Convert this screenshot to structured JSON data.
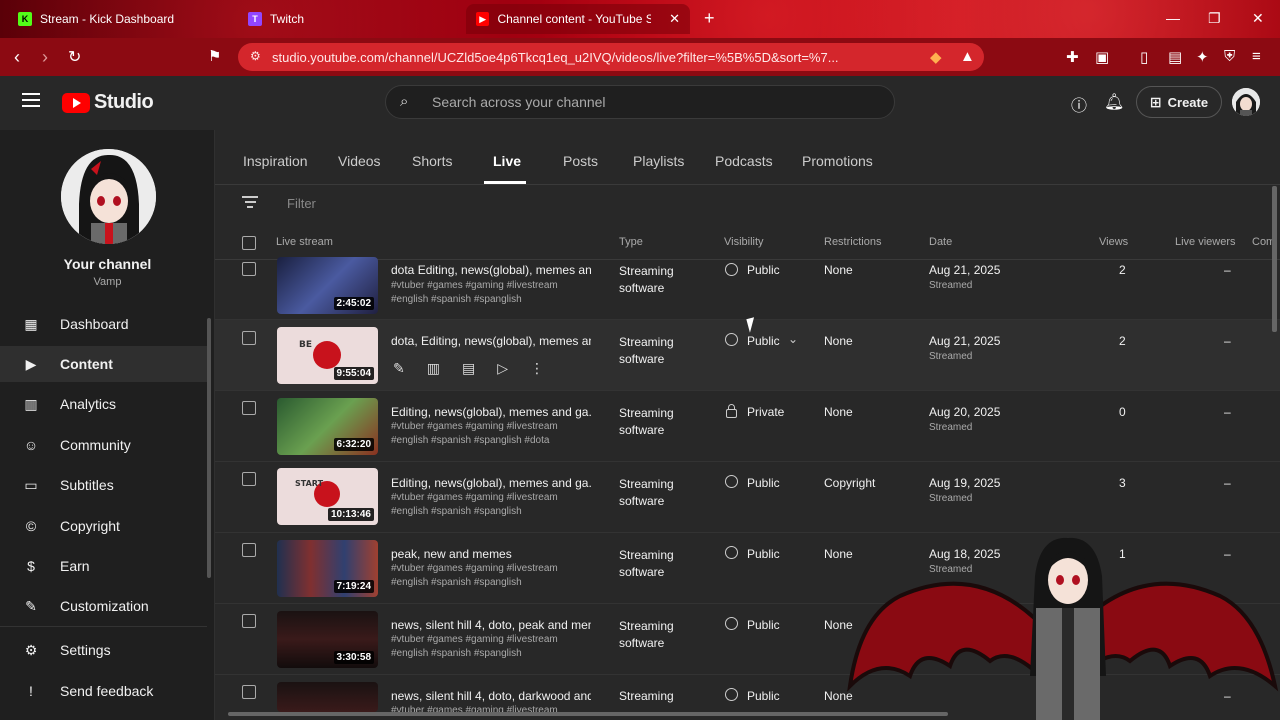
{
  "browser": {
    "tabs": [
      {
        "label": "Stream - Kick Dashboard",
        "fav_color": "#53fc18",
        "fav_glyph": "K"
      },
      {
        "label": "Twitch",
        "fav_color": "#9146ff",
        "fav_glyph": "T"
      },
      {
        "label": "Channel content - YouTube Stud",
        "fav_color": "#ff0000",
        "fav_glyph": "▶"
      }
    ],
    "url": "studio.youtube.com/channel/UCZld5oe4p6Tkcq1eq_u2IVQ/videos/live?filter=%5B%5D&sort=%7..."
  },
  "header": {
    "logo_text": "Studio",
    "search_placeholder": "Search across your channel",
    "create_label": "Create"
  },
  "sidebar": {
    "channel_title": "Your channel",
    "channel_name": "Vamp",
    "items": [
      {
        "label": "Dashboard",
        "icon": "dashboard-icon",
        "glyph": "▦"
      },
      {
        "label": "Content",
        "icon": "content-icon",
        "glyph": "▶"
      },
      {
        "label": "Analytics",
        "icon": "analytics-icon",
        "glyph": "▥"
      },
      {
        "label": "Community",
        "icon": "community-icon",
        "glyph": "☺"
      },
      {
        "label": "Subtitles",
        "icon": "subtitles-icon",
        "glyph": "▭"
      },
      {
        "label": "Copyright",
        "icon": "copyright-icon",
        "glyph": "©"
      },
      {
        "label": "Earn",
        "icon": "earn-icon",
        "glyph": "$"
      },
      {
        "label": "Customization",
        "icon": "customization-icon",
        "glyph": "✎"
      },
      {
        "label": "Settings",
        "icon": "settings-icon",
        "glyph": "⚙"
      },
      {
        "label": "Send feedback",
        "icon": "feedback-icon",
        "glyph": "!"
      }
    ]
  },
  "content_tabs": [
    "Inspiration",
    "Videos",
    "Shorts",
    "Live",
    "Posts",
    "Playlists",
    "Podcasts",
    "Promotions"
  ],
  "filter_placeholder": "Filter",
  "columns": {
    "live_stream": "Live stream",
    "type": "Type",
    "visibility": "Visibility",
    "restrictions": "Restrictions",
    "date": "Date",
    "views": "Views",
    "live_viewers": "Live viewers",
    "comments": "Com"
  },
  "rows": [
    {
      "title": "dota Editing, news(global), memes an...",
      "desc": "#vtuber #games #gaming #livestream #english #spanish #spanglish",
      "duration": "2:45:02",
      "type": "Streaming software",
      "visibility": "Public",
      "restrictions": "None",
      "date": "Aug 21, 2025",
      "date_sub": "Streamed",
      "views": "2",
      "live_viewers": "–",
      "thumb": "#2a3050"
    },
    {
      "title": "dota, Editing, news(global), memes an...",
      "desc": "",
      "duration": "9:55:04",
      "type": "Streaming software",
      "visibility": "Public",
      "restrictions": "None",
      "date": "Aug 21, 2025",
      "date_sub": "Streamed",
      "views": "2",
      "live_viewers": "–",
      "thumb": "#e8d6d6"
    },
    {
      "title": "Editing, news(global), memes and ga...",
      "desc": "#vtuber #games #gaming #livestream #english #spanish #spanglish #dota",
      "duration": "6:32:20",
      "type": "Streaming software",
      "visibility": "Private",
      "restrictions": "None",
      "date": "Aug 20, 2025",
      "date_sub": "Streamed",
      "views": "0",
      "live_viewers": "–",
      "thumb": "#3a6a40"
    },
    {
      "title": "Editing, news(global), memes and ga...",
      "desc": "#vtuber #games #gaming #livestream #english #spanish #spanglish",
      "duration": "10:13:46",
      "type": "Streaming software",
      "visibility": "Public",
      "restrictions": "Copyright",
      "date": "Aug 19, 2025",
      "date_sub": "Streamed",
      "views": "3",
      "live_viewers": "–",
      "thumb": "#ead8d8"
    },
    {
      "title": "peak, new and memes",
      "desc": "#vtuber #games #gaming #livestream #english #spanish #spanglish",
      "duration": "7:19:24",
      "type": "Streaming software",
      "visibility": "Public",
      "restrictions": "None",
      "date": "Aug 18, 2025",
      "date_sub": "Streamed",
      "views": "1",
      "live_viewers": "–",
      "thumb": "#304060"
    },
    {
      "title": "news, silent hill 4, doto, peak and mem...",
      "desc": "#vtuber #games #gaming #livestream #english #spanish #spanglish",
      "duration": "3:30:58",
      "type": "Streaming software",
      "visibility": "Public",
      "restrictions": "None",
      "date": "",
      "date_sub": "",
      "views": "",
      "live_viewers": "",
      "thumb": "#1a1414"
    },
    {
      "title": "news, silent hill 4, doto, darkwood and ...",
      "desc": "#vtuber #games #gaming #livestream",
      "duration": "",
      "type": "Streaming",
      "visibility": "Public",
      "restrictions": "None",
      "date": "",
      "date_sub": "",
      "views": "",
      "live_viewers": "–",
      "thumb": "#1a1414"
    }
  ],
  "colors": {
    "accent": "#ff0000",
    "browser_red": "#c8121c"
  }
}
